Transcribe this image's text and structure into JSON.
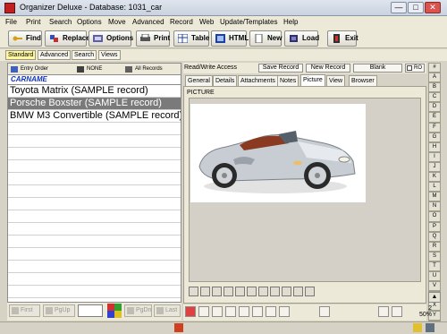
{
  "window": {
    "title": "Organizer Deluxe - Database: 1031_car",
    "min": "—",
    "max": "□",
    "close": "✕"
  },
  "menu": [
    "File",
    "Print",
    "Search",
    "Options",
    "Move",
    "Advanced",
    "Record",
    "Web",
    "Update/Templates",
    "Help"
  ],
  "toolbar": {
    "find": "Find",
    "replace": "Replace",
    "options": "Options",
    "print": "Print",
    "table": "Table",
    "html": "HTML",
    "new": "New",
    "load": "Load",
    "exit": "Exit"
  },
  "modes": [
    "Standard",
    "Advanced",
    "Search",
    "Views"
  ],
  "list": {
    "entry_order": "Entry Order",
    "none": "NONE",
    "all_records": "All Records",
    "column": "CARNAME",
    "rows": [
      "Toyota Matrix (SAMPLE record)",
      "Porsche Boxster (SAMPLE record)",
      "BMW M3 Convertible (SAMPLE record)"
    ],
    "selected_index": 1
  },
  "nav": {
    "first": "First",
    "pgup": "PgUp",
    "pgdn": "PgDn",
    "last": "Last",
    "page_value": ""
  },
  "record_bar": {
    "mode": "Read/Write Access",
    "save": "Save Record",
    "new": "New Record",
    "blank": "Blank",
    "ro": "RO"
  },
  "tabs": [
    "General",
    "Details",
    "Attachments",
    "Notes",
    "Picture",
    "View",
    "Browser"
  ],
  "active_tab": "Picture",
  "picture": {
    "label": "PICTURE"
  },
  "alpha": [
    "#",
    "A",
    "B",
    "C",
    "D",
    "E",
    "F",
    "G",
    "H",
    "I",
    "J",
    "K",
    "L",
    "M",
    "N",
    "O",
    "P",
    "Q",
    "R",
    "S",
    "T",
    "U",
    "V",
    "W",
    "X",
    "Y",
    "Z"
  ],
  "zoom": {
    "count": "2",
    "level": "50%"
  },
  "colors": {
    "accent": "#1030c0",
    "selected_row": "#7a7a7a",
    "active_mode": "#fff8a0",
    "car_silver": "#c8cdd3",
    "car_interior": "#8a3a20"
  }
}
